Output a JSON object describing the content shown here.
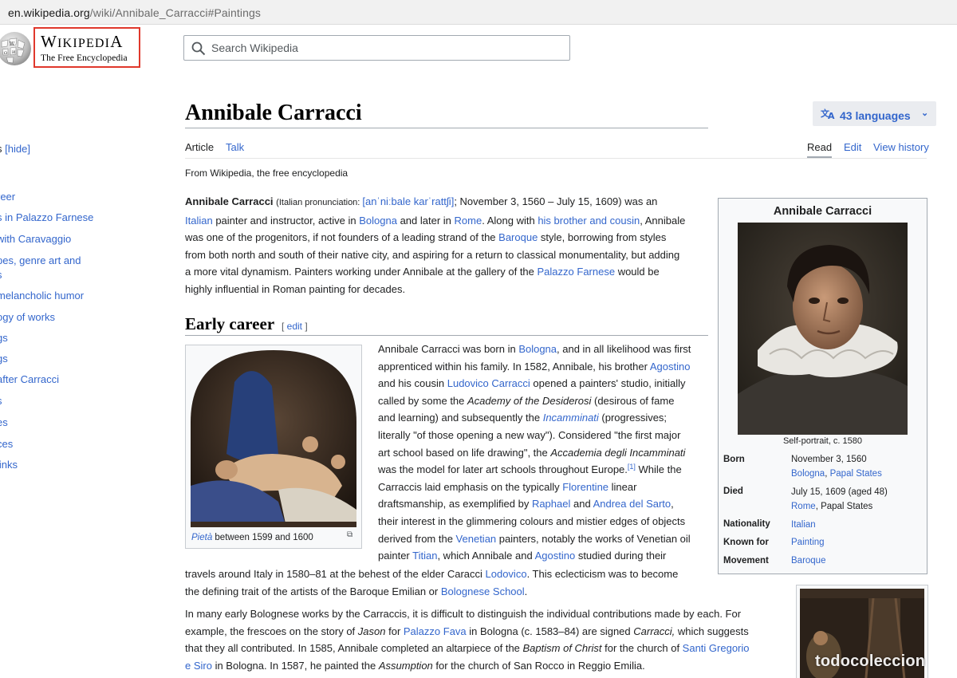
{
  "browser": {
    "url_host": "en.wikipedia.org",
    "url_path": "/wiki/Annibale_Carracci#Paintings"
  },
  "logo": {
    "wordmark_1": "Wikipedia",
    "wordmark_1_W": "W",
    "wordmark_1_rest": "IKIPEDI",
    "wordmark_1_A": "A",
    "wordmark_2": "The Free Encyclopedia",
    "highlight_color": "#e0382c"
  },
  "search": {
    "placeholder": "Search Wikipedia"
  },
  "toc": {
    "header": "s",
    "hide": "[hide]",
    "items": [
      "reer",
      "s in Palazzo Farnese",
      " with Caravaggio",
      "pes, genre art and",
      "s",
      "melancholic humor",
      "ogy of works",
      "gs",
      "gs",
      "after Carracci",
      "s",
      "es",
      "ces",
      " links"
    ]
  },
  "article": {
    "title": "Annibale Carracci",
    "languages": "43 languages",
    "tabs": {
      "article": "Article",
      "talk": "Talk",
      "read": "Read",
      "edit": "Edit",
      "history": "View history"
    },
    "tagline": "From Wikipedia, the free encyclopedia",
    "lead": {
      "name": "Annibale Carracci",
      "pron_label": "Italian pronunciation:",
      "ipa": "[anˈniːbale karˈrattʃi]",
      "dates": "; November 3, 1560 – July 15, 1609) was an",
      "l2a": "Italian",
      "l2b": " painter and instructor, active in ",
      "l2c": "Bologna",
      "l2d": " and later in ",
      "l2e": "Rome",
      "l2f": ". Along with ",
      "l2g": "his brother and cousin",
      "l2h": ", Annibale",
      "l3a": "was one of the progenitors, if not founders of a leading strand of the ",
      "l3b": "Baroque",
      "l3c": " style, borrowing from styles",
      "l4": "from both north and south of their native city, and aspiring for a return to classical monumentality, but adding",
      "l5a": "a more vital dynamism. Painters working under Annibale at the gallery of the ",
      "l5b": "Palazzo Farnese",
      "l5c": " would be",
      "l6": "highly influential in Roman painting for decades."
    },
    "section": {
      "heading": "Early career",
      "edit": "edit",
      "lines": {
        "a1": "Annibale Carracci was born in ",
        "a2": "Bologna",
        "a3": ", and in all likelihood was first",
        "b1": "apprenticed within his family. In 1582, Annibale, his brother ",
        "b2": "Agostino",
        "c1": "and his cousin ",
        "c2": "Ludovico Carracci",
        "c3": " opened a painters' studio, initially",
        "d1": "called by some the ",
        "d2": "Academy of the Desiderosi",
        "d3": " (desirous of fame",
        "e1": "and learning) and subsequently the ",
        "e2": "Incamminati",
        "e3": " (progressives;",
        "f1": "literally \"of those opening a new way\"). Considered \"the first major",
        "g1": "art school based on life drawing\", the ",
        "g2": "Accademia degli Incamminati",
        "h1": "was the model for later art schools throughout Europe.",
        "h2": "[1]",
        "h3": " While the",
        "i1": "Carraccis laid emphasis on the typically ",
        "i2": "Florentine",
        "i3": " linear",
        "j1": "draftsmanship, as exemplified by ",
        "j2": "Raphael",
        "j3": " and ",
        "j4": "Andrea del Sarto",
        "j5": ",",
        "k1": "their interest in the glimmering colours and mistier edges of objects",
        "l1": "derived from the ",
        "l2": "Venetian",
        "l3": " painters, notably the works of Venetian oil",
        "m1": "painter ",
        "m2": "Titian",
        "m3": ", which Annibale and ",
        "m4": "Agostino",
        "m5": " studied during their",
        "n1": "travels around Italy in 1580–81 at the behest of the elder Caracci ",
        "n2": "Lodovico",
        "n3": ". This eclecticism was to become",
        "o1": "the defining trait of the artists of the Baroque Emilian or ",
        "o2": "Bolognese School",
        "o3": "."
      },
      "p2": {
        "a": "In many early Bolognese works by the Carraccis, it is difficult to distinguish the individual contributions made by each. For",
        "b1": "example, the frescoes on the story of ",
        "b2": "Jason",
        "b3": " for ",
        "b4": "Palazzo Fava",
        "b5": " in Bologna (c. 1583–84) are signed ",
        "b6": "Carracci,",
        "b7": " which suggests",
        "c1": "that they all contributed. In 1585, Annibale completed an altarpiece of the ",
        "c2": "Baptism of Christ",
        "c3": " for the church of ",
        "c4": "Santi Gregorio",
        "d1": "e Siro",
        "d2": " in Bologna. In 1587, he painted the ",
        "d3": "Assumption",
        "d4": " for the church of San Rocco in Reggio Emilia."
      }
    },
    "thumb": {
      "caption_italic": "Pietà",
      "caption_rest": " between 1599 and 1600"
    },
    "infobox": {
      "title": "Annibale Carracci",
      "caption": "Self-portrait, c. 1580",
      "born_label": "Born",
      "born_date": "November 3, 1560",
      "born_place_1": "Bologna",
      "born_place_2": "Papal States",
      "died_label": "Died",
      "died_date": "July 15, 1609 (aged 48)",
      "died_place_1": "Rome",
      "died_place_2": ", Papal States",
      "nationality_label": "Nationality",
      "nationality": "Italian",
      "known_label": "Known for",
      "known": "Painting",
      "movement_label": "Movement",
      "movement": "Baroque"
    }
  },
  "watermark": "todocoleccion",
  "colors": {
    "link": "#3366cc",
    "text": "#202122",
    "rule": "#a2a9b1",
    "infobox_bg": "#f8f9fa"
  }
}
